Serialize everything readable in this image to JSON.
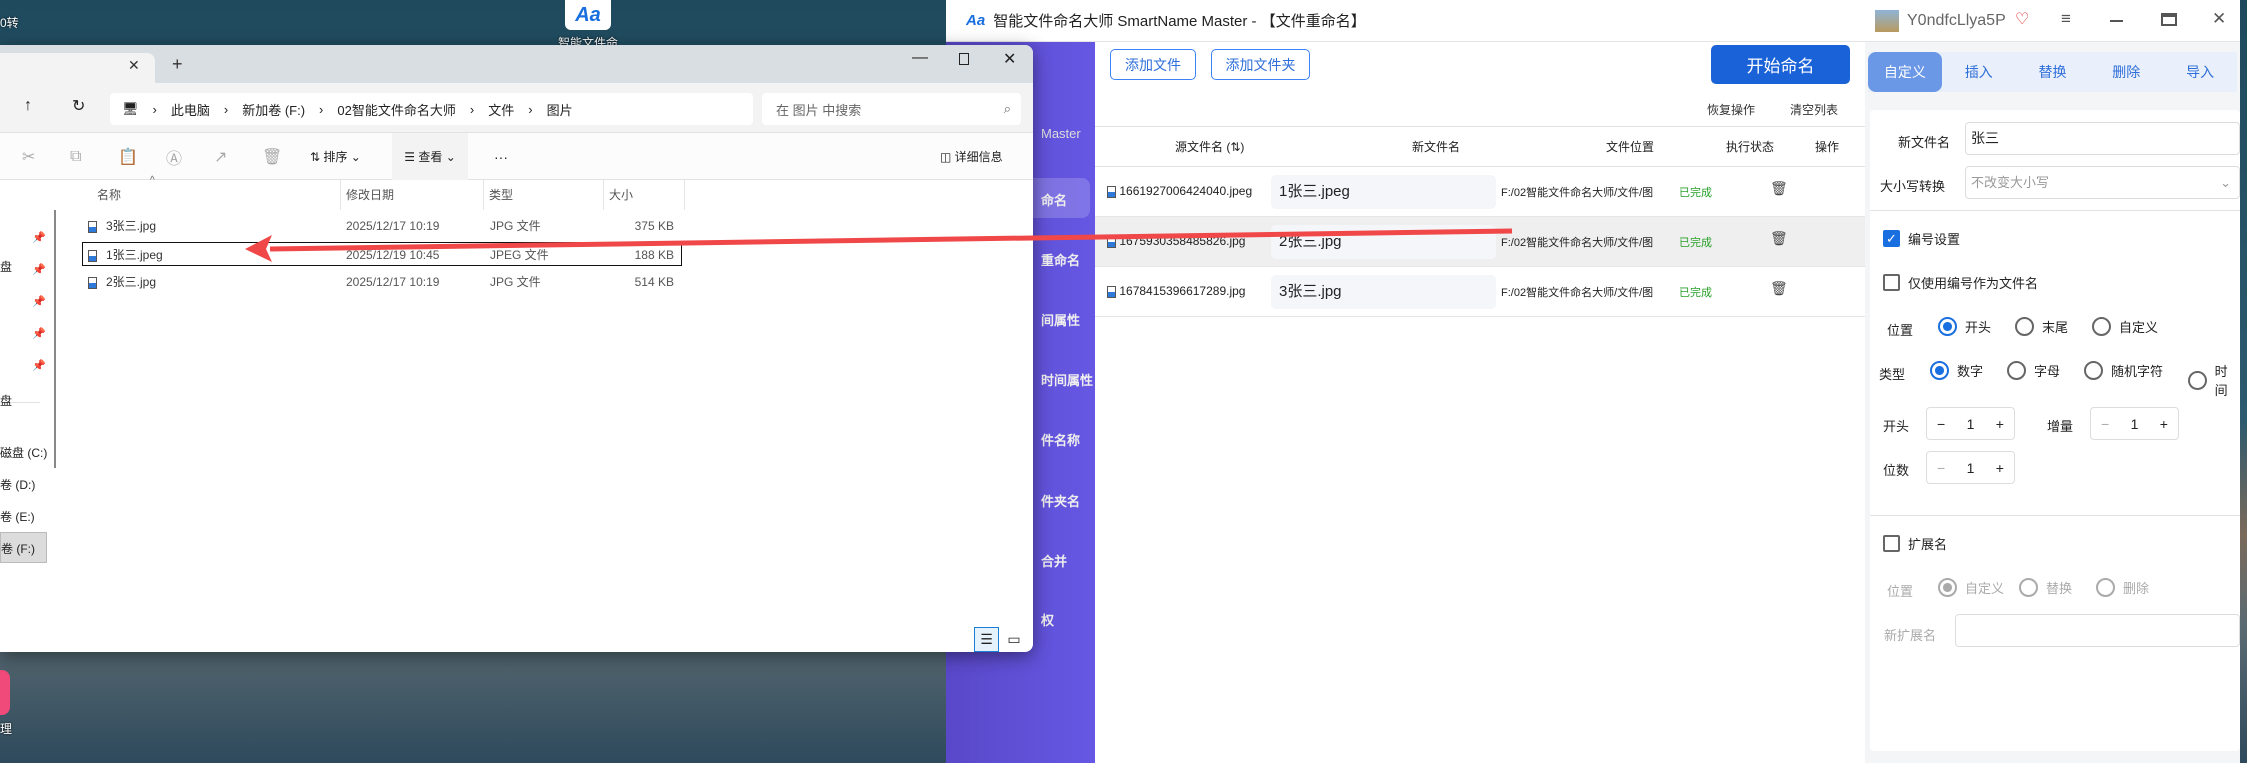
{
  "desktop": {
    "top_label": "0转",
    "app_label": "智能文件命",
    "pink_label": "理"
  },
  "explorer": {
    "path": [
      "此电脑",
      "新加卷 (F:)",
      "02智能文件命名大师",
      "文件",
      "图片"
    ],
    "search_placeholder": "在 图片 中搜索",
    "toolbar": {
      "sort": "排序",
      "view": "查看",
      "more": "···",
      "details": "详细信息"
    },
    "columns": [
      "名称",
      "修改日期",
      "类型",
      "大小"
    ],
    "files": [
      {
        "name": "3张三.jpg",
        "date": "2025/12/17 10:19",
        "type": "JPG 文件",
        "size": "375 KB"
      },
      {
        "name": "1张三.jpeg",
        "date": "2025/12/19 10:45",
        "type": "JPEG 文件",
        "size": "188 KB"
      },
      {
        "name": "2张三.jpg",
        "date": "2025/12/17 10:19",
        "type": "JPG 文件",
        "size": "514 KB"
      }
    ],
    "nav": [
      "盘",
      "盘",
      "磁盘 (C:)",
      "卷 (D:)",
      "卷 (E:)",
      "卷 (F:)"
    ]
  },
  "app": {
    "title": "智能文件命名大师 SmartName Master - 【文件重命名】",
    "sidebar_brand": "Master",
    "sidebar": [
      "命名",
      "重命名",
      "间属性",
      "时间属性",
      "件名称",
      "件夹名",
      "合并",
      "权"
    ],
    "add_file": "添加文件",
    "add_folder": "添加文件夹",
    "start": "开始命名",
    "restore": "恢复操作",
    "clear": "清空列表",
    "headers": [
      "源文件名 (⇅)",
      "新文件名",
      "文件位置",
      "执行状态",
      "操作"
    ],
    "rows": [
      {
        "src": "1661927006424040.jpeg",
        "new": "1张三.jpeg",
        "loc": "F:/02智能文件命名大师/文件/图片",
        "status": "已完成"
      },
      {
        "src": "1675930358485826.jpg",
        "new": "2张三.jpg",
        "loc": "F:/02智能文件命名大师/文件/图片",
        "status": "已完成"
      },
      {
        "src": "1678415396617289.jpg",
        "new": "3张三.jpg",
        "loc": "F:/02智能文件命名大师/文件/图片",
        "status": "已完成"
      }
    ],
    "user": "Y0ndfcLlya5P",
    "tabs": [
      "自定义",
      "插入",
      "替换",
      "删除",
      "导入"
    ],
    "form": {
      "newname_label": "新文件名",
      "newname": "张三",
      "case_label": "大小写转换",
      "case_value": "不改变大小写",
      "numbering": "编号设置",
      "only_number": "仅使用编号作为文件名",
      "pos_label": "位置",
      "pos_opts": [
        "开头",
        "末尾",
        "自定义"
      ],
      "type_label": "类型",
      "type_opts": [
        "数字",
        "字母",
        "随机字符",
        "时间"
      ],
      "start_label": "开头",
      "start": "1",
      "inc_label": "增量",
      "inc": "1",
      "digits_label": "位数",
      "digits": "1",
      "ext": "扩展名",
      "ext_pos_label": "位置",
      "ext_opts": [
        "自定义",
        "替换",
        "删除"
      ],
      "new_ext_label": "新扩展名",
      "new_ext": ""
    }
  },
  "colors": {
    "accent": "#1a6fe0",
    "sidebar": "#6658e4",
    "done": "#2aa02a",
    "arrow": "#f04848"
  }
}
